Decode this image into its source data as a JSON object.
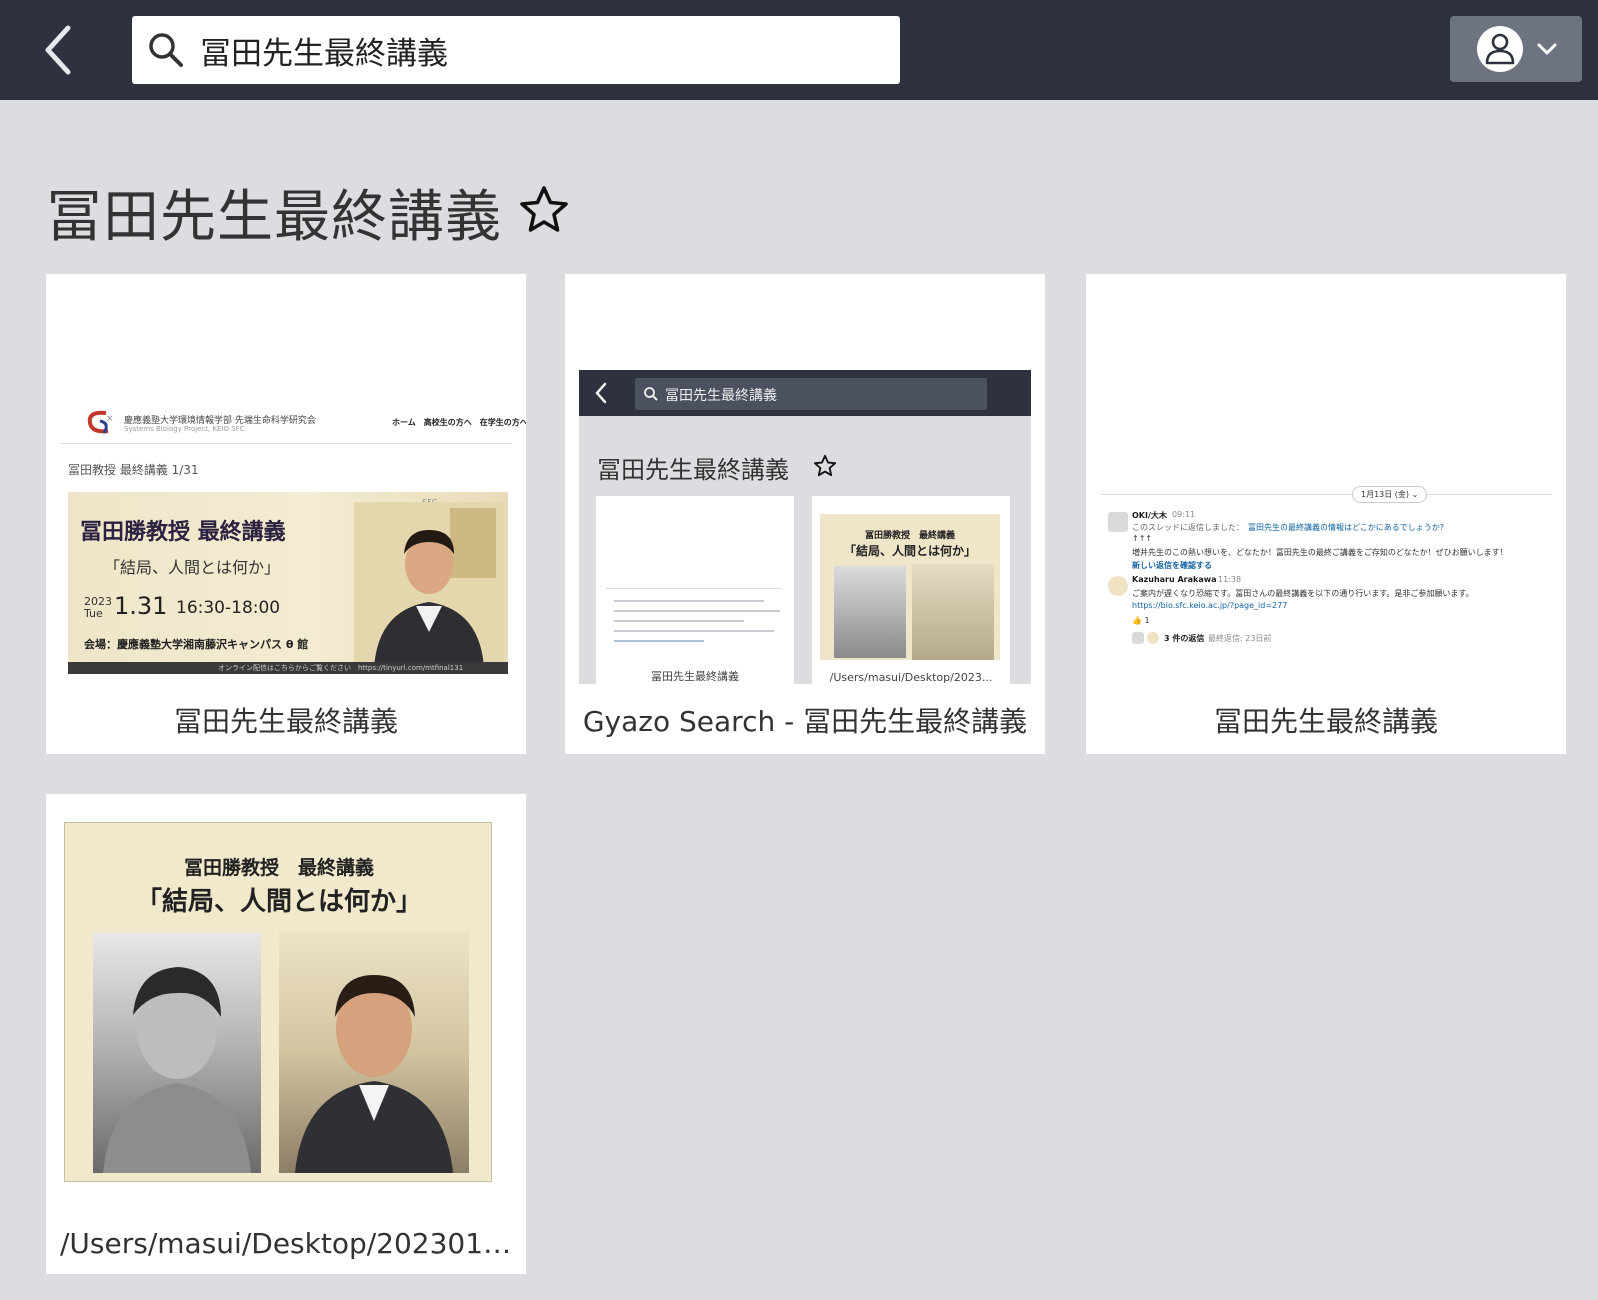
{
  "search": {
    "query": "冨田先生最終講義"
  },
  "page": {
    "title": "冨田先生最終講義"
  },
  "cards": [
    {
      "caption": "冨田先生最終講義",
      "thumb": {
        "org_name": "慶應義塾大学環境情報学部 先端生命科学研究会",
        "org_sub": "Systems Biology Project, KEIO SFC",
        "nav": "ホーム　高校生の方へ　在学生の方へ",
        "subtitle": "冨田教授 最終講義 1/31",
        "sfc_mark": "SFC",
        "banner_title": "冨田勝教授 最終講義",
        "banner_subtitle": "「結局、人間とは何か」",
        "year": "2023",
        "weekday": "Tue",
        "date": "1.31",
        "time": "16:30-18:00",
        "venue": "会場：慶應義塾大学湘南藤沢キャンパス θ 館",
        "footer": "オンライン配信はこちらからご覧ください　https://tinyurl.com/mtfinal131"
      }
    },
    {
      "caption": "Gyazo Search - 冨田先生最終講義",
      "thumb": {
        "search_text": "冨田先生最終講義",
        "title": "冨田先生最終講義",
        "mini1_caption": "冨田先生最終講義",
        "mini2_caption": "/Users/masui/Desktop/2023...",
        "poster_line1": "冨田勝教授　最終講義",
        "poster_line2": "「結局、人間とは何か」"
      }
    },
    {
      "caption": "冨田先生最終講義",
      "thumb": {
        "date_pill": "1月13日 (金) ⌄",
        "user1": "OKI/大木",
        "user1_time": "09:11",
        "reply_prefix": "このスレッドに返信しました：",
        "reply_link": "冨田先生の最終講義の情報はどこかにあるでしょうか?",
        "arrows": "↑↑↑",
        "line1": "増井先生のこの熱い想いを、どなたか！冨田先生の最終ご講義をご存知のどなたか！ぜひお願いします！",
        "see_new": "新しい返信を確認する",
        "user2": "Kazuharu Arakawa",
        "user2_time": "11:38",
        "line2": "ご案内が遅くなり恐縮です。冨田さんの最終講義を以下の通り行います。是非ご参加願います。",
        "link": "https://bio.sfc.keio.ac.jp/?page_id=277",
        "reaction": "👍 1",
        "replies": "3 件の返信",
        "last_reply": "最終返信: 23日前"
      }
    },
    {
      "caption": "/Users/masui/Desktop/202301_...",
      "thumb": {
        "poster_line1": "冨田勝教授　最終講義",
        "poster_line2": "「結局、人間とは何か」"
      }
    }
  ],
  "icons": {
    "back": "chevron-left-icon",
    "search": "magnifier-icon",
    "user": "user-avatar-icon",
    "menu": "chevron-down-icon",
    "favorite": "star-outline-icon"
  },
  "colors": {
    "topbar": "#2d323e",
    "background": "#dcdde0",
    "card": "#ffffff",
    "user_button": "#6e7380"
  }
}
